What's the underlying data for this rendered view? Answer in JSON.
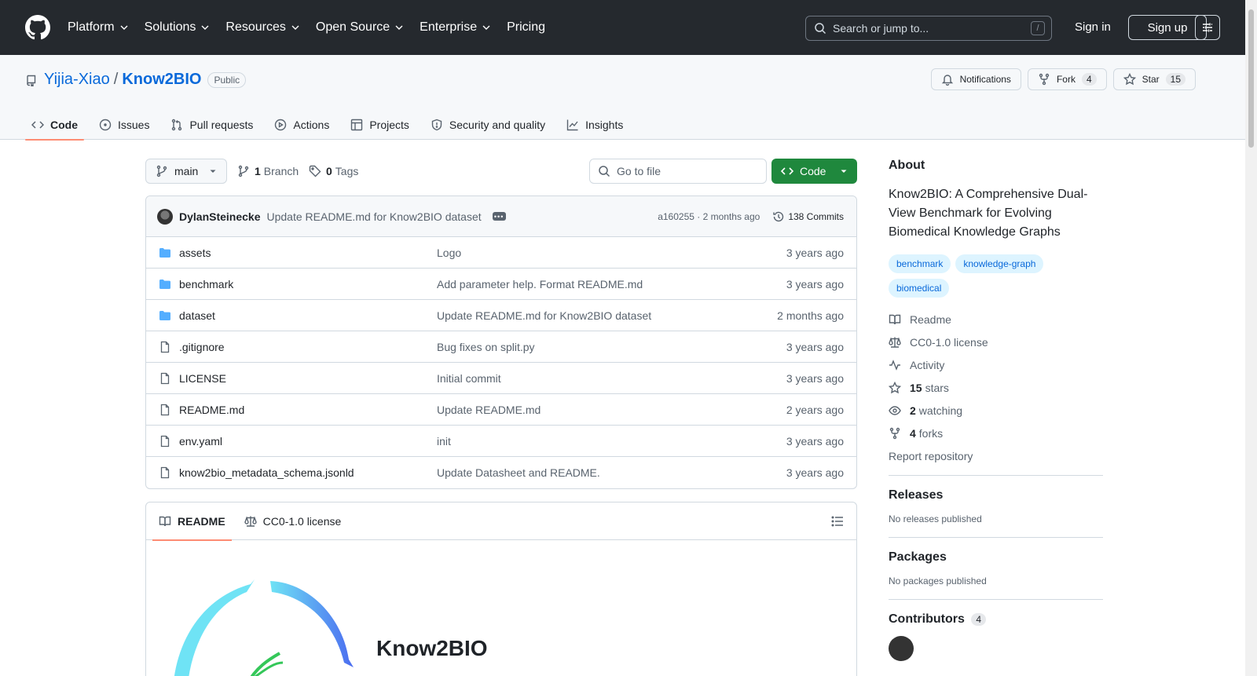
{
  "header": {
    "nav": [
      "Platform",
      "Solutions",
      "Resources",
      "Open Source",
      "Enterprise",
      "Pricing"
    ],
    "search_placeholder": "Search or jump to...",
    "slash_key": "/",
    "sign_in": "Sign in",
    "sign_up": "Sign up"
  },
  "repo": {
    "owner": "Yijia-Xiao",
    "slash": "/",
    "name": "Know2BIO",
    "visibility": "Public",
    "notifications_label": "Notifications",
    "fork_label": "Fork",
    "fork_count": "4",
    "star_label": "Star",
    "star_count": "15",
    "tabs": [
      "Code",
      "Issues",
      "Pull requests",
      "Actions",
      "Projects",
      "Security and quality",
      "Insights"
    ]
  },
  "toolbar": {
    "branch": "main",
    "branch_count": "1",
    "branch_label": "Branch",
    "tag_count": "0",
    "tag_label": "Tags",
    "goto_placeholder": "Go to file",
    "code_label": "Code"
  },
  "commit": {
    "author": "DylanSteinecke",
    "message": "Update README.md for Know2BIO dataset",
    "dots": "•••",
    "hash_time": "a160255 · 2 months ago",
    "commits_label": "138 Commits"
  },
  "files": [
    {
      "type": "folder",
      "name": "assets",
      "message": "Logo",
      "time": "3 years ago"
    },
    {
      "type": "folder",
      "name": "benchmark",
      "message": "Add parameter help. Format README.md",
      "time": "3 years ago"
    },
    {
      "type": "folder",
      "name": "dataset",
      "message": "Update README.md for Know2BIO dataset",
      "time": "2 months ago"
    },
    {
      "type": "file",
      "name": ".gitignore",
      "message": "Bug fixes on split.py",
      "time": "3 years ago"
    },
    {
      "type": "file",
      "name": "LICENSE",
      "message": "Initial commit",
      "time": "3 years ago"
    },
    {
      "type": "file",
      "name": "README.md",
      "message": "Update README.md",
      "time": "2 years ago"
    },
    {
      "type": "file",
      "name": "env.yaml",
      "message": "init",
      "time": "3 years ago"
    },
    {
      "type": "file",
      "name": "know2bio_metadata_schema.jsonld",
      "message": "Update Datasheet and README.",
      "time": "3 years ago"
    }
  ],
  "readme": {
    "tab_readme": "README",
    "tab_license": "CC0-1.0 license",
    "heading": "Know2BIO"
  },
  "sidebar": {
    "about_heading": "About",
    "description": "Know2BIO: A Comprehensive Dual-View Benchmark for Evolving Biomedical Knowledge Graphs",
    "topics": [
      "benchmark",
      "knowledge-graph",
      "biomedical"
    ],
    "readme": "Readme",
    "license": "CC0-1.0 license",
    "activity": "Activity",
    "stars_count": "15",
    "stars_label": "stars",
    "watching_count": "2",
    "watching_label": "watching",
    "forks_count": "4",
    "forks_label": "forks",
    "report": "Report repository",
    "releases_heading": "Releases",
    "releases_empty": "No releases published",
    "packages_heading": "Packages",
    "packages_empty": "No packages published",
    "contributors_heading": "Contributors",
    "contributors_count": "4"
  },
  "colors": {
    "header_bg": "#25292e",
    "link": "#0969da",
    "primary_button": "#1f883d",
    "active_tab_underline": "#fd8c73",
    "folder": "#54aeff"
  }
}
